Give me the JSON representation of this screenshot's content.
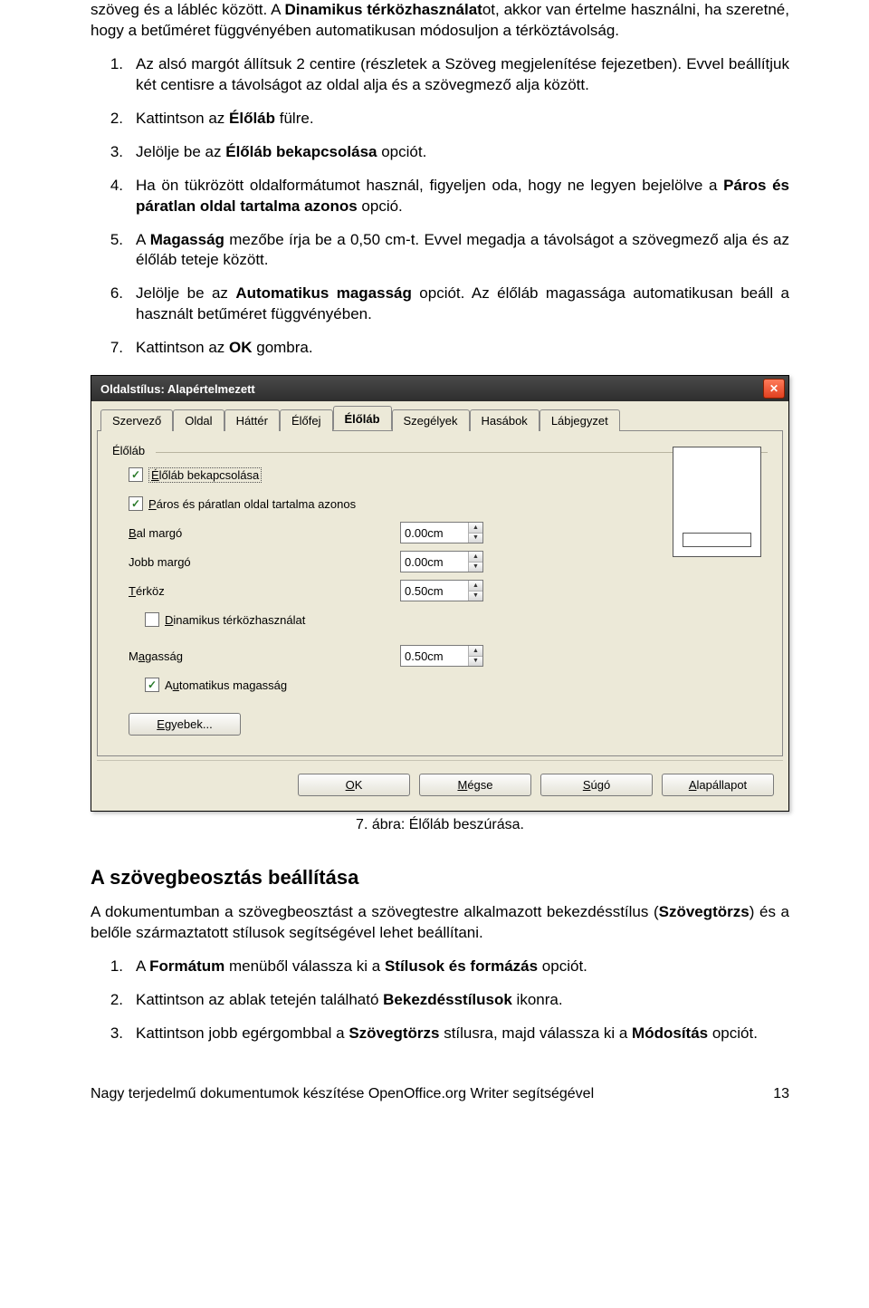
{
  "intro": "szöveg és a lábléc között. A Dinamikus térközhasználatot, akkor van értelme használni, ha szeretné, hogy a betűméret függvényében automatikusan módosuljon a térköztávolság.",
  "steps": [
    {
      "n": "1.",
      "t": "Az alsó margót állítsuk 2 centire (részletek a Szöveg megjelenítése fejezetben). Evvel beállítjuk két centisre a távolságot az oldal alja és a szövegmező alja között."
    },
    {
      "n": "2.",
      "t": "Kattintson az Élőláb fülre.",
      "b": [
        "Élőláb"
      ]
    },
    {
      "n": "3.",
      "t": "Jelölje be az Élőláb bekapcsolása opciót.",
      "b": [
        "Élőláb bekapcsolása"
      ]
    },
    {
      "n": "4.",
      "t": "Ha ön tükrözött oldalformátumot használ, figyeljen oda, hogy ne legyen bejelölve a Páros és páratlan oldal tartalma azonos opció.",
      "b": [
        "Páros és páratlan oldal tartalma azonos"
      ]
    },
    {
      "n": "5.",
      "t": "A Magasság mezőbe írja be a 0,50 cm-t. Evvel megadja a távolságot a szövegmező alja és az élőláb teteje között.",
      "b": [
        "Magasság"
      ]
    },
    {
      "n": "6.",
      "t": "Jelölje be az Automatikus magasság opciót. Az élőláb magassága automatikusan beáll a használt betűméret függvényében.",
      "b": [
        "Automatikus magasság"
      ]
    },
    {
      "n": "7.",
      "t": "Kattintson az OK gombra.",
      "b": [
        "OK"
      ]
    }
  ],
  "dialog": {
    "title": "Oldalstílus: Alapértelmezett",
    "tabs": [
      "Szervező",
      "Oldal",
      "Háttér",
      "Élőfej",
      "Élőláb",
      "Szegélyek",
      "Hasábok",
      "Lábjegyzet"
    ],
    "active_tab": "Élőláb",
    "group": "Élőláb",
    "opt_enable": "Élőláb bekapcsolása",
    "opt_same": "Páros és páratlan oldal tartalma azonos",
    "left_margin": {
      "label": "Bal margó",
      "value": "0.00cm"
    },
    "right_margin": {
      "label": "Jobb margó",
      "value": "0.00cm"
    },
    "spacing": {
      "label": "Térköz",
      "value": "0.50cm"
    },
    "dyn_spacing": "Dinamikus térközhasználat",
    "height": {
      "label": "Magasság",
      "value": "0.50cm"
    },
    "auto_height": "Automatikus magasság",
    "more": "Egyebek...",
    "ok": "OK",
    "cancel": "Mégse",
    "help": "Súgó",
    "reset": "Alapállapot"
  },
  "caption": "7. ábra: Élőláb beszúrása.",
  "section2": {
    "title": "A szövegbeosztás beállítása",
    "para": "A dokumentumban a szövegbeosztást a szövegtestre alkalmazott bekezdésstílus (Szövegtörzs) és a belőle származtatott stílusok segítségével lehet beállítani.",
    "steps": [
      {
        "n": "1.",
        "t": "A Formátum menüből válassza ki a Stílusok és formázás opciót.",
        "b": [
          "Formátum",
          "Stílusok és formázás"
        ]
      },
      {
        "n": "2.",
        "t": "Kattintson az ablak tetején található Bekezdésstílusok ikonra.",
        "b": [
          "Bekezdésstílusok"
        ]
      },
      {
        "n": "3.",
        "t": "Kattintson jobb egérgombbal a Szövegtörzs stílusra, majd válassza ki a Módosítás opciót.",
        "b": [
          "Szövegtörzs",
          "Módosítás"
        ]
      }
    ]
  },
  "footer": {
    "left": "Nagy terjedelmű dokumentumok készítése OpenOffice.org Writer segítségével",
    "right": "13"
  }
}
